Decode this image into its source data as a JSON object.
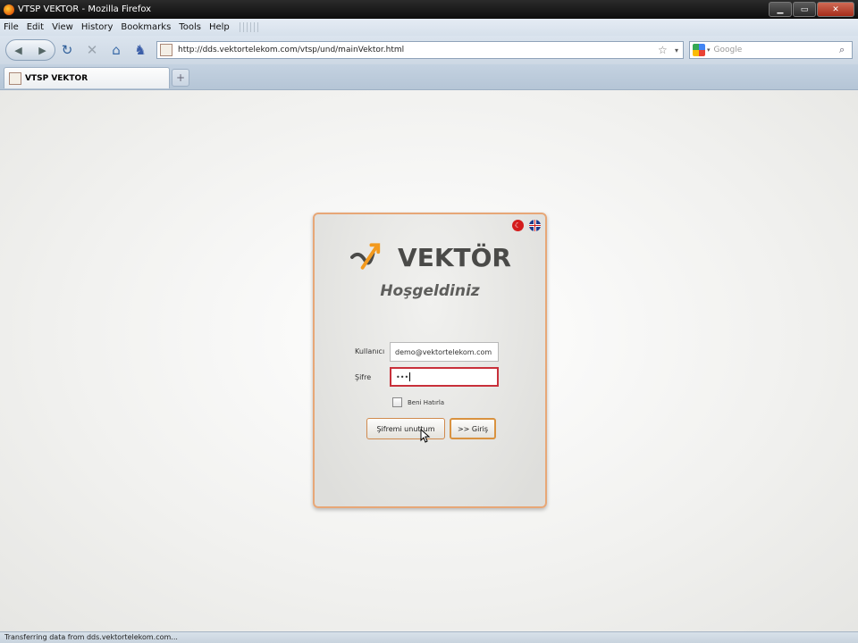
{
  "window": {
    "title": "VTSP VEKTOR - Mozilla Firefox"
  },
  "menu": {
    "items": [
      "File",
      "Edit",
      "View",
      "History",
      "Bookmarks",
      "Tools",
      "Help"
    ]
  },
  "navbar": {
    "url": "http://dds.vektortelekom.com/vtsp/und/mainVektor.html",
    "search_placeholder": "Google"
  },
  "tabs": [
    {
      "label": "VTSP VEKTOR"
    }
  ],
  "login": {
    "logo_text": "VEKTÖR",
    "welcome": "Hoşgeldiniz",
    "username_label": "Kullanıcı",
    "username_value": "demo@vektortelekom.com",
    "password_label": "Şifre",
    "password_value": "•••",
    "remember_label": "Beni Hatırla",
    "forgot_button": "Şifremi unuttum",
    "login_button": ">> Giriş",
    "languages": [
      "tr",
      "en"
    ]
  },
  "status": {
    "text": "Transferring data from dds.vektortelekom.com..."
  },
  "colors": {
    "accent": "#e7a777",
    "error_border": "#c8303a",
    "logo_orange": "#f39a1e"
  }
}
